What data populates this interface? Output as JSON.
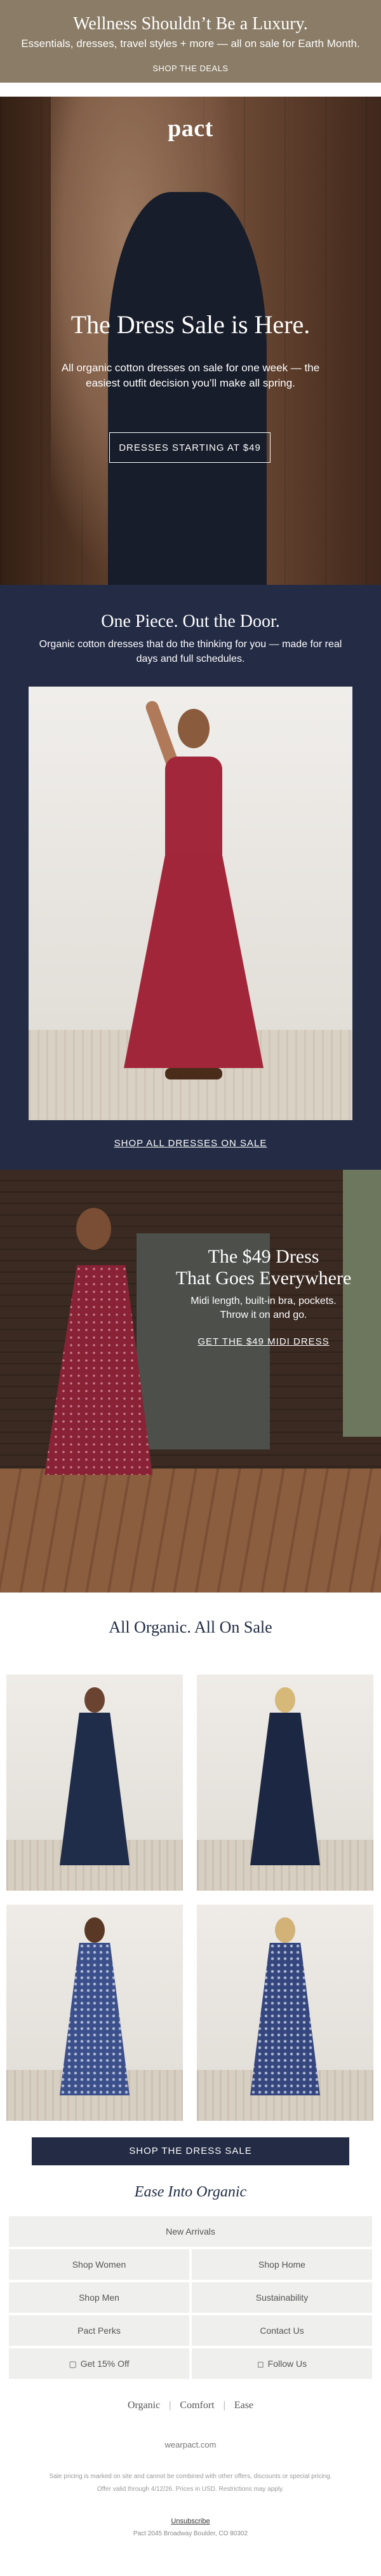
{
  "top_banner": {
    "title": "Wellness Shouldn’t Be a Luxury.",
    "subtitle": "Essentials, dresses, travel styles + more — all on sale for Earth Month.",
    "cta": "SHOP THE DEALS",
    "bg_color": "#8a7c66"
  },
  "hero": {
    "logo": "pact",
    "title": "The Dress Sale is Here.",
    "subtitle": "All organic cotton dresses on sale for one week — the easiest outfit decision you’ll make all spring.",
    "cta": "DRESSES STARTING AT $49"
  },
  "section_one_piece": {
    "title": "One Piece. Out the Door.",
    "subtitle": "Organic cotton dresses that do the thinking for you — made for real days and full schedules.",
    "cta": "SHOP ALL DRESSES ON SALE",
    "bg_color": "#232b45"
  },
  "section_midi": {
    "title_line1": "The $49 Dress",
    "title_line2": "That Goes Everywhere",
    "subtitle_line1": "Midi length, built-in bra, pockets.",
    "subtitle_line2": "Throw it on and go.",
    "cta": "GET THE $49 MIDI DRESS"
  },
  "grid": {
    "title": "All Organic. All On Sale",
    "cta": "SHOP THE DRESS SALE"
  },
  "ease": {
    "title": "Ease Into Organic",
    "full_link": "New Arrivals",
    "links": [
      "Shop Women",
      "Shop Home",
      "Shop Men",
      "Sustainability",
      "Pact Perks",
      "Contact Us"
    ],
    "offer": "Get 15% Off",
    "follow": "Follow Us",
    "offer_icon": "chat-icon",
    "follow_icon": "instagram-icon"
  },
  "footer": {
    "tagline": [
      "Organic",
      "Comfort",
      "Ease"
    ],
    "site": "wearpact.com",
    "legal_line1": "Sale pricing is marked on site and cannot be combined with other offers, discounts or special pricing.",
    "legal_line2": "Offer valid through 4/12/26. Prices in USD. Restrictions may apply.",
    "unsubscribe": "Unsubscribe",
    "address": "Pact 2045 Broadway Boulder, CO 80302"
  }
}
